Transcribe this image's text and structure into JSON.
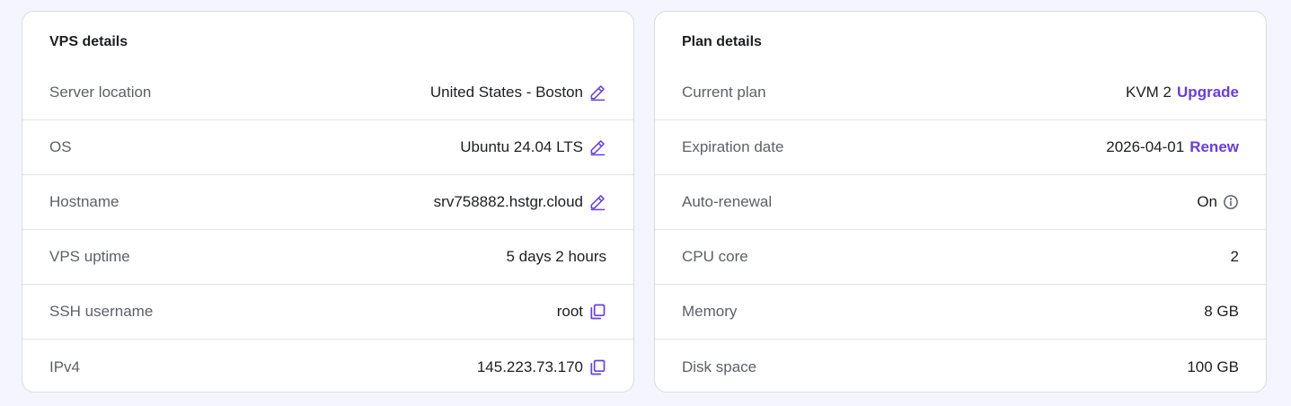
{
  "vps_details": {
    "title": "VPS details",
    "rows": [
      {
        "label": "Server location",
        "value": "United States - Boston",
        "icon": "edit-icon"
      },
      {
        "label": "OS",
        "value": "Ubuntu 24.04 LTS",
        "icon": "edit-icon"
      },
      {
        "label": "Hostname",
        "value": "srv758882.hstgr.cloud",
        "icon": "edit-icon"
      },
      {
        "label": "VPS uptime",
        "value": "5 days 2 hours"
      },
      {
        "label": "SSH username",
        "value": "root",
        "icon": "copy-icon"
      },
      {
        "label": "IPv4",
        "value": "145.223.73.170",
        "icon": "copy-icon"
      }
    ]
  },
  "plan_details": {
    "title": "Plan details",
    "rows": [
      {
        "label": "Current plan",
        "value": "KVM 2",
        "action": "Upgrade"
      },
      {
        "label": "Expiration date",
        "value": "2026-04-01",
        "action": "Renew"
      },
      {
        "label": "Auto-renewal",
        "value": "On",
        "icon": "info-icon"
      },
      {
        "label": "CPU core",
        "value": "2"
      },
      {
        "label": "Memory",
        "value": "8 GB"
      },
      {
        "label": "Disk space",
        "value": "100 GB"
      }
    ]
  },
  "colors": {
    "accent": "#673de6",
    "label": "#5e6068",
    "text": "#1d1e20",
    "background": "#f4f5ff",
    "card": "#ffffff",
    "divider": "#e3e4e8"
  }
}
